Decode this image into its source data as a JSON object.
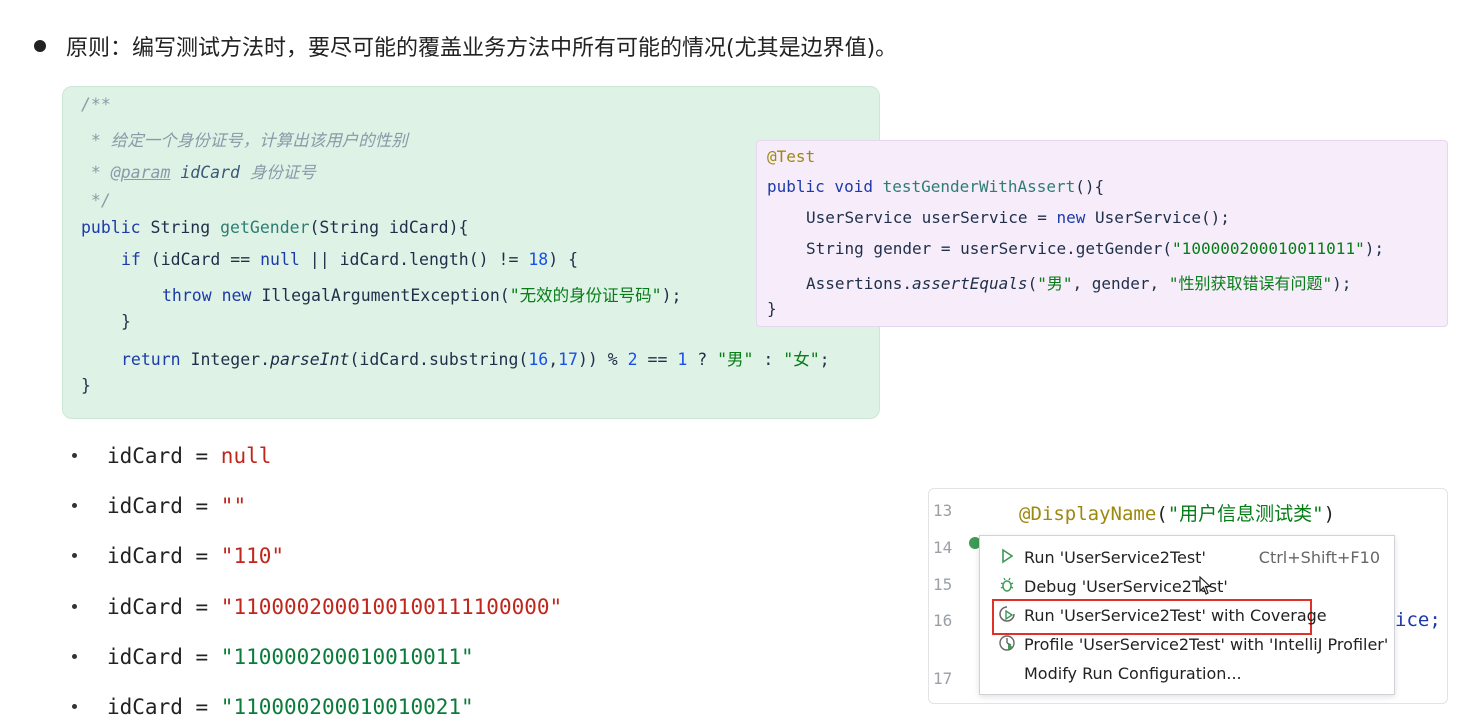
{
  "principle": "原则：编写测试方法时，要尽可能的覆盖业务方法中所有可能的情况(尤其是边界值)。",
  "code_main": {
    "c1": "/**",
    "c2": " * 给定一个身份证号，计算出该用户的性别",
    "c3_tag": "@param",
    "c3_name": "idCard",
    "c3_desc": "身份证号",
    "c4": " */",
    "sig_kw": "public",
    "sig_type": "String",
    "sig_name": "getGender",
    "sig_params": "(String idCard){",
    "if_kw": "if",
    "if_a": " (idCard == ",
    "if_null": "null",
    "if_b": " || idCard.length() != ",
    "if_num": "18",
    "if_c": ") {",
    "throw_kw": "throw",
    "new_kw": "new",
    "throw_cls": " IllegalArgumentException(",
    "throw_str": "\"无效的身份证号码\"",
    "throw_end": ");",
    "close_if": "}",
    "ret_kw": "return",
    "ret_a": " Integer.",
    "ret_parse": "parseInt",
    "ret_b": "(idCard.substring(",
    "ret_n16": "16",
    "ret_comma": ",",
    "ret_n17": "17",
    "ret_c": ")) % ",
    "ret_n2": "2",
    "ret_d": " == ",
    "ret_n1": "1",
    "ret_e": " ? ",
    "ret_male": "\"男\"",
    "ret_f": " : ",
    "ret_female": "\"女\"",
    "ret_end": ";",
    "close_fn": "}"
  },
  "code_test": {
    "annotation": "@Test",
    "l2_kw": "public void",
    "l2_name": "testGenderWithAssert",
    "l2_end": "(){",
    "l3_a": "UserService userService = ",
    "l3_new": "new",
    "l3_b": " UserService();",
    "l4_a": "String gender = userService.getGender(",
    "l4_str": "\"100000200010011011\"",
    "l4_end": ");",
    "l5_a": "Assertions.",
    "l5_method": "assertEquals",
    "l5_b": "(",
    "l5_s1": "\"男\"",
    "l5_c": ", gender, ",
    "l5_s2": "\"性别获取错误有问题\"",
    "l5_end": ");",
    "close": "}"
  },
  "idcards": [
    {
      "label": "idCard = ",
      "value": "null"
    },
    {
      "label": "idCard = ",
      "value": "\"\""
    },
    {
      "label": "idCard = ",
      "value": "\"110\""
    },
    {
      "label": "idCard = ",
      "value": "\"1100002000100100111100000\""
    },
    {
      "label": "idCard = ",
      "value": "\"110000200010010011\""
    },
    {
      "label": "idCard = ",
      "value": "\"110000200010010021\""
    }
  ],
  "ide": {
    "line_numbers": [
      "13",
      "14",
      "15",
      "16",
      "17"
    ],
    "annotation": "@DisplayName",
    "annotation_arg_open": "(",
    "annotation_str": "\"用户信息测试类\"",
    "annotation_arg_close": ")",
    "service_tail": "ice;"
  },
  "context_menu": {
    "items": [
      {
        "label": "Run 'UserService2Test'",
        "shortcut": "Ctrl+Shift+F10",
        "icon": "run-icon"
      },
      {
        "label": "Debug 'UserService2Test'",
        "shortcut": "",
        "icon": "debug-icon"
      },
      {
        "label": "Run 'UserService2Test' with Coverage",
        "shortcut": "",
        "icon": "coverage-icon"
      },
      {
        "label": "Profile 'UserService2Test' with 'IntelliJ Profiler'",
        "shortcut": "",
        "icon": "profiler-icon"
      },
      {
        "label": "Modify Run Configuration...",
        "shortcut": "",
        "icon": ""
      }
    ]
  },
  "colors": {
    "code_main_bg": "#dff2e6",
    "code_test_bg": "#f6ecfa",
    "highlight_box": "#e0302a"
  }
}
